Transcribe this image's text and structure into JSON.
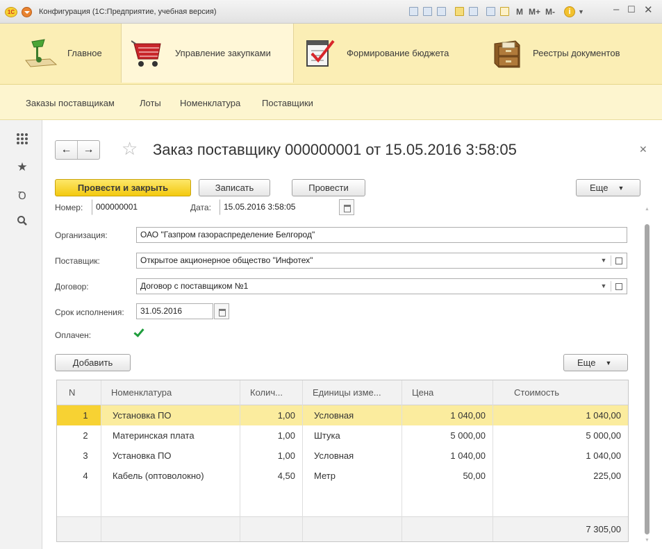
{
  "window": {
    "title": "Конфигурация  (1С:Предприятие, учебная версия)",
    "logo": "1С",
    "toolbar_m": "M",
    "toolbar_mplus": "M+",
    "toolbar_mminus": "M-",
    "info": "i"
  },
  "sections": [
    {
      "label": "Главное",
      "icon": "desk-lamp-icon"
    },
    {
      "label": "Управление закупками",
      "icon": "shopping-cart-icon"
    },
    {
      "label": "Формирование бюджета",
      "icon": "checklist-icon"
    },
    {
      "label": "Реестры документов",
      "icon": "file-cabinet-icon"
    }
  ],
  "nav": [
    "Заказы поставщикам",
    "Лоты",
    "Номенклатура",
    "Поставщики"
  ],
  "form": {
    "title": "Заказ поставщику 000000001 от 15.05.2016 3:58:05",
    "buttons": {
      "post_close": "Провести и закрыть",
      "save": "Записать",
      "post": "Провести",
      "more": "Еще"
    },
    "number_label": "Номер:",
    "number_value": "000000001",
    "date_label": "Дата:",
    "date_value": "15.05.2016  3:58:05",
    "org_label": "Организация:",
    "org_value": "ОАО \"Газпром газораспределение Белгород\"",
    "supplier_label": "Поставщик:",
    "supplier_value": "Открытое акционерное общество \"Инфотех\"",
    "contract_label": "Договор:",
    "contract_value": "Договор с поставщиком №1",
    "deadline_label": "Срок исполнения:",
    "deadline_value": "31.05.2016",
    "paid_label": "Оплачен:",
    "paid": true
  },
  "table": {
    "add_button": "Добавить",
    "more_button": "Еще",
    "columns": [
      "N",
      "Номенклатура",
      "Колич...",
      "Единицы изме...",
      "Цена",
      "Стоимость"
    ],
    "rows": [
      {
        "n": "1",
        "item": "Установка ПО",
        "qty": "1,00",
        "unit": "Условная",
        "price": "1 040,00",
        "cost": "1 040,00"
      },
      {
        "n": "2",
        "item": "Материнская плата",
        "qty": "1,00",
        "unit": "Штука",
        "price": "5 000,00",
        "cost": "5 000,00"
      },
      {
        "n": "3",
        "item": "Установка ПО",
        "qty": "1,00",
        "unit": "Условная",
        "price": "1 040,00",
        "cost": "1 040,00"
      },
      {
        "n": "4",
        "item": "Кабель (оптоволокно)",
        "qty": "4,50",
        "unit": "Метр",
        "price": "50,00",
        "cost": "225,00"
      }
    ],
    "total": "7 305,00"
  },
  "colors": {
    "sections_bg": "#fbeeb5",
    "primary_button": "#f6d535",
    "selected_row": "#fbec9e",
    "check": "#1e9d3c"
  }
}
